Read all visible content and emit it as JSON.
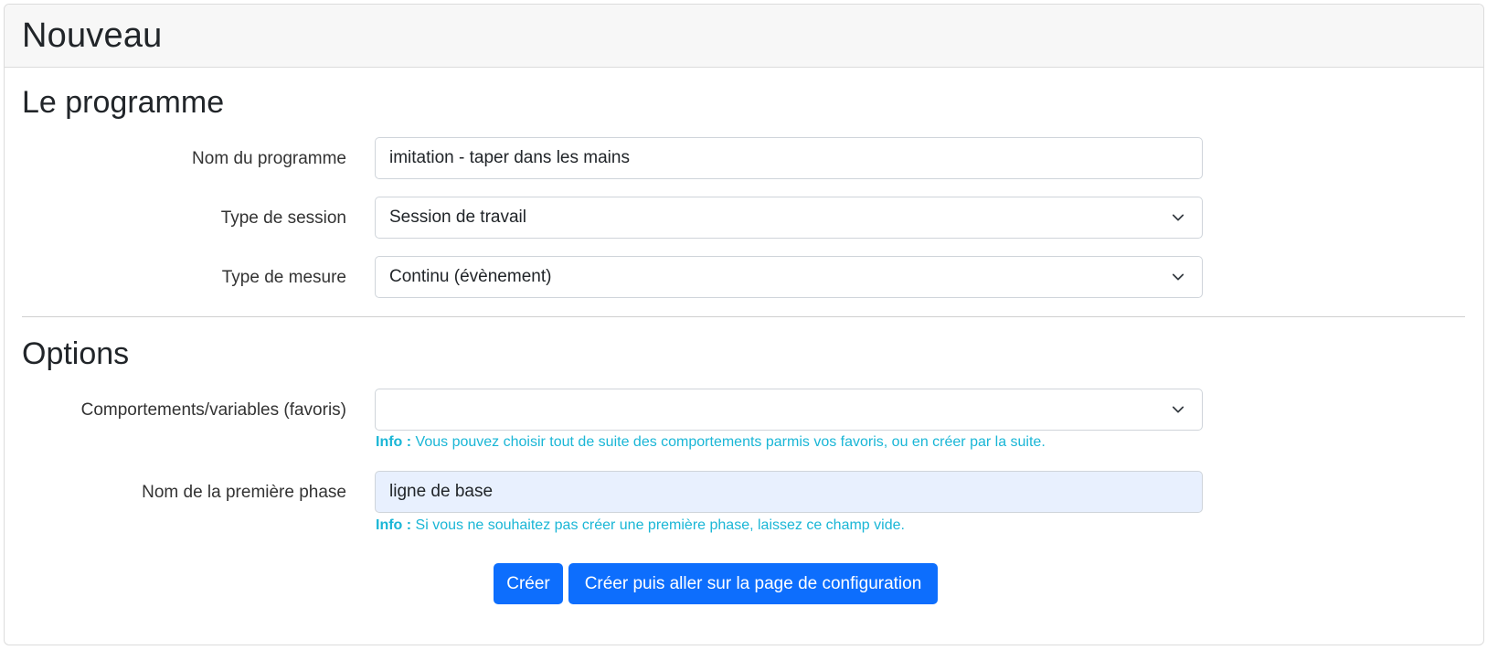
{
  "card": {
    "title": "Nouveau"
  },
  "section_program": {
    "title": "Le programme",
    "program_name": {
      "label": "Nom du programme",
      "value": "imitation - taper dans les mains"
    },
    "session_type": {
      "label": "Type de session",
      "selected": "Session de travail"
    },
    "measure_type": {
      "label": "Type de mesure",
      "selected": "Continu (évènement)"
    }
  },
  "section_options": {
    "title": "Options",
    "behaviors": {
      "label": "Comportements/variables (favoris)",
      "selected": "",
      "info_prefix": "Info :",
      "info_text": "Vous pouvez choisir tout de suite des comportements parmis vos favoris, ou en créer par la suite."
    },
    "first_phase": {
      "label": "Nom de la première phase",
      "value": "ligne de base",
      "info_prefix": "Info :",
      "info_text": "Si vous ne souhaitez pas créer une première phase, laissez ce champ vide."
    }
  },
  "actions": {
    "create_label": "Créer",
    "create_configure_label": "Créer puis aller sur la page de configuration"
  },
  "colors": {
    "primary": "#0d6efd",
    "info": "#1ab6d6",
    "autofill_bg": "#e8f0fe"
  },
  "icons": {
    "select_arrow": "chevron-down-icon"
  }
}
